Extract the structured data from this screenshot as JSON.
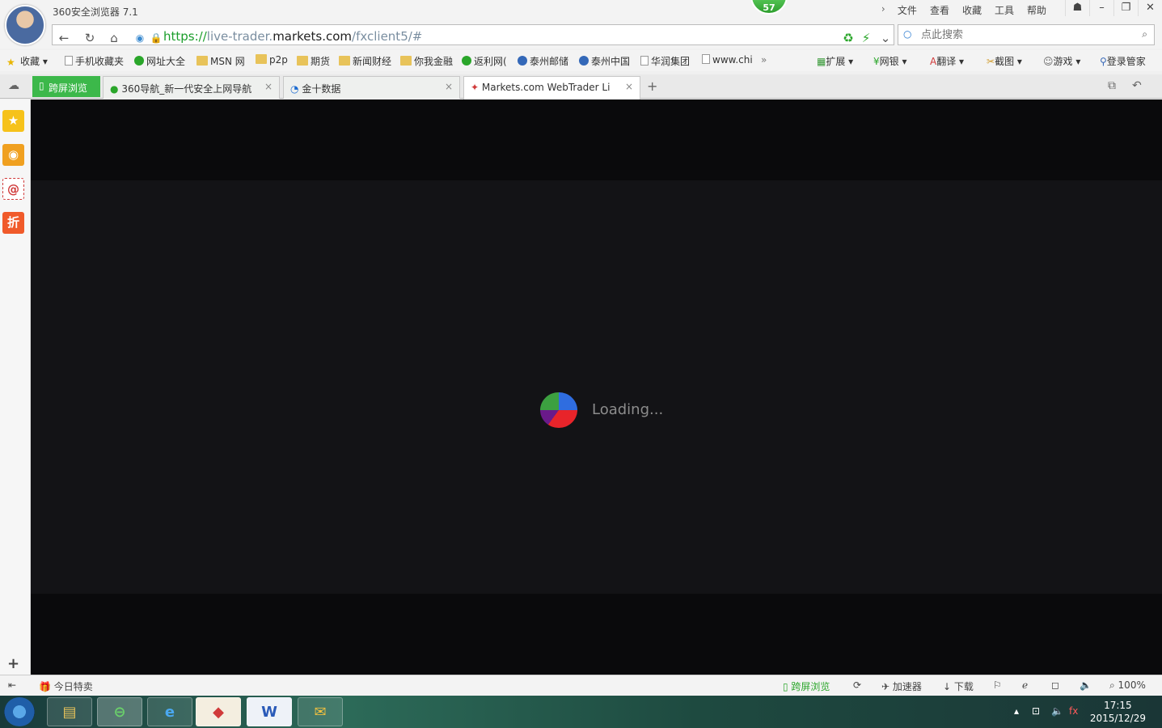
{
  "window": {
    "title": "360安全浏览器 7.1",
    "notification_count": "57",
    "menu": [
      "文件",
      "查看",
      "收藏",
      "工具",
      "帮助"
    ]
  },
  "address": {
    "url_scheme": "https://",
    "url_sub": "live-trader.",
    "url_domain": "markets.com",
    "url_path": "/fxclient5/#",
    "search_placeholder": "点此搜索"
  },
  "bookmarks": [
    "收藏",
    "手机收藏夹",
    "网址大全",
    "MSN 网",
    "p2p",
    "期货",
    "新闻财经",
    "你我金融",
    "返利网(",
    "泰州邮储",
    "泰州中国",
    "华润集团",
    "www.chi"
  ],
  "toolbar_right": [
    "扩展",
    "网银",
    "翻译",
    "截图",
    "游戏",
    "登录管家"
  ],
  "tabs": {
    "kuaping": "跨屏浏览",
    "items": [
      {
        "label": "360导航_新一代安全上网导航"
      },
      {
        "label": "金十数据"
      },
      {
        "label": "Markets.com WebTrader Li"
      }
    ]
  },
  "content": {
    "loading_text": "Loading..."
  },
  "statusbar": {
    "left_label": "今日特卖",
    "items": [
      "跨屏浏览",
      "加速器",
      "下载"
    ],
    "zoom": "100%"
  },
  "taskbar": {
    "time": "17:15",
    "date": "2015/12/29"
  },
  "colors": {
    "accent_green": "#3cb84a",
    "content_bg": "#0a0a0c",
    "loading_text": "#8c8c8c"
  }
}
